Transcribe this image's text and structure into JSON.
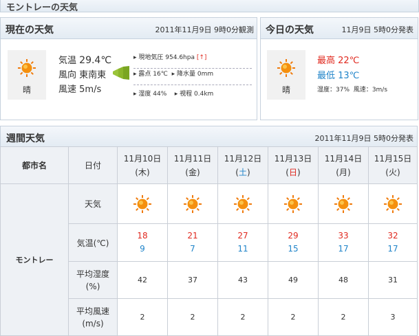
{
  "page_title": "モントレーの天気",
  "current": {
    "title": "現在の天気",
    "observed": "2011年11月9日 9時0分観測",
    "weather": "晴",
    "temp_label": "気温",
    "temp_value": "29.4℃",
    "wind_dir_label": "風向",
    "wind_dir_value": "東南東",
    "wind_speed_label": "風速",
    "wind_speed_value": "5m/s",
    "pressure_label": "現地気圧",
    "pressure_value": "954.6hpa",
    "pressure_trend": "[↑]",
    "dew_label": "露点",
    "dew_value": "16℃",
    "precip_label": "降水量",
    "precip_value": "0mm",
    "humidity_label": "湿度",
    "humidity_value": "44%",
    "visibility_label": "視程",
    "visibility_value": "0.4km"
  },
  "today": {
    "title": "今日の天気",
    "issued": "11月9日 5時0分発表",
    "weather": "晴",
    "high_label": "最高",
    "high_value": "22℃",
    "low_label": "最低",
    "low_value": "13℃",
    "humidity_label": "湿度",
    "humidity_value": "37%",
    "wind_label": "風速",
    "wind_value": "3m/s"
  },
  "weekly": {
    "title": "週間天気",
    "issued": "2011年11月9日 5時0分発表",
    "col_city": "都市名",
    "col_date": "日付",
    "city": "モントレー",
    "row_weather": "天気",
    "row_temp": "気温(℃)",
    "row_humidity_1": "平均湿度",
    "row_humidity_2": "(%)",
    "row_wind_1": "平均風速",
    "row_wind_2": "(m/s)",
    "days": [
      {
        "date": "11月10日",
        "dow": "木",
        "dow_color": "#333333",
        "high": "18",
        "low": "9",
        "humidity": "42",
        "wind": "2"
      },
      {
        "date": "11月11日",
        "dow": "金",
        "dow_color": "#333333",
        "high": "21",
        "low": "7",
        "humidity": "37",
        "wind": "2"
      },
      {
        "date": "11月12日",
        "dow": "土",
        "dow_color": "#2084c9",
        "high": "27",
        "low": "11",
        "humidity": "43",
        "wind": "2"
      },
      {
        "date": "11月13日",
        "dow": "日",
        "dow_color": "#e0281e",
        "high": "29",
        "low": "15",
        "humidity": "49",
        "wind": "2"
      },
      {
        "date": "11月14日",
        "dow": "月",
        "dow_color": "#333333",
        "high": "33",
        "low": "17",
        "humidity": "48",
        "wind": "2"
      },
      {
        "date": "11月15日",
        "dow": "火",
        "dow_color": "#333333",
        "high": "32",
        "low": "17",
        "humidity": "31",
        "wind": "3"
      }
    ]
  },
  "colors": {
    "high": "#e0281e",
    "low": "#2084c9",
    "header_bg": "#e3ebf3",
    "border": "#c6d1dd"
  },
  "icons": {
    "weather": "sun-icon",
    "wind": "wind-direction-icon"
  }
}
